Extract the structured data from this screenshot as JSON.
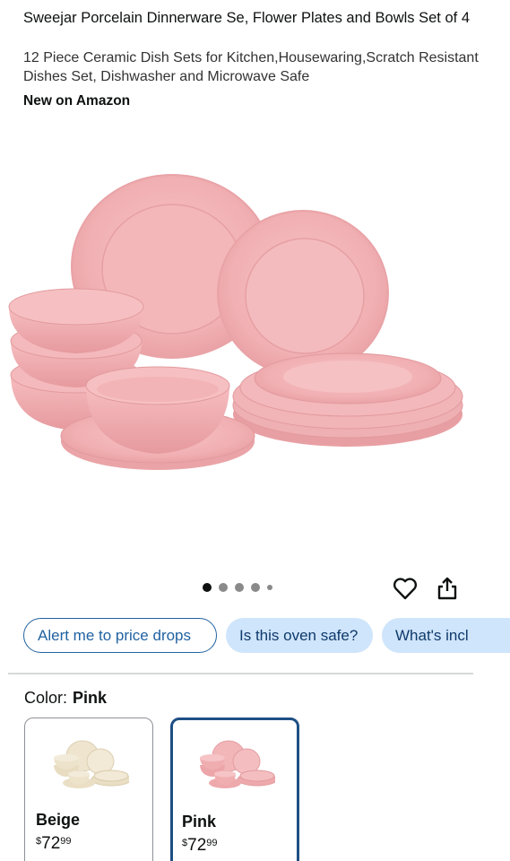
{
  "product": {
    "title": "Sweejar Porcelain Dinnerware Se, Flower Plates and Bowls Set of 4",
    "subtitle": "12 Piece Ceramic Dish Sets for Kitchen,Housewaring,Scratch Resistant Dishes Set, Dishwasher and Microwave Safe",
    "badge": "New on Amazon"
  },
  "gallery": {
    "image_icon": "pink-dinnerware-set-image",
    "dots_total": 5,
    "active_dot": 1
  },
  "actions": {
    "wishlist_icon": "heart-icon",
    "share_icon": "share-icon"
  },
  "chips": [
    {
      "label": "Alert me to price drops"
    },
    {
      "label": "Is this oven safe?"
    },
    {
      "label": "What's incl"
    }
  ],
  "color": {
    "label": "Color:",
    "selected": "Pink",
    "options": [
      {
        "name": "Beige",
        "currency": "$",
        "whole": "72",
        "cents": "99"
      },
      {
        "name": "Pink",
        "currency": "$",
        "whole": "72",
        "cents": "99"
      }
    ]
  },
  "colors": {
    "link_blue": "#2162a1",
    "chip_fill": "#cfe5fb",
    "selected_border": "#1e4f85",
    "pink": "#f2b6b9",
    "beige": "#efe5cf"
  }
}
